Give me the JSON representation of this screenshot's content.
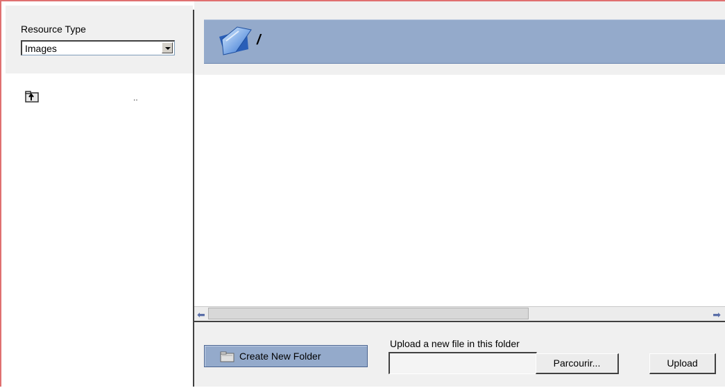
{
  "resource_type": {
    "label": "Resource Type",
    "selected": "Images"
  },
  "tree": {
    "up_item_label": ".."
  },
  "header": {
    "path": "/"
  },
  "actions": {
    "create_folder_label": "Create New Folder",
    "upload_label": "Upload a new file in this folder",
    "browse_label": "Parcourir...",
    "upload_button_label": "Upload"
  },
  "icons": {
    "up": "folder-up-icon",
    "header": "open-folder-icon",
    "new_folder": "new-folder-icon",
    "scroll_left": "arrow-left-icon",
    "scroll_right": "arrow-right-icon"
  },
  "colors": {
    "header_bg": "#94aacb",
    "panel_bg": "#f0f0f0",
    "frame_accent": "#e07070"
  }
}
